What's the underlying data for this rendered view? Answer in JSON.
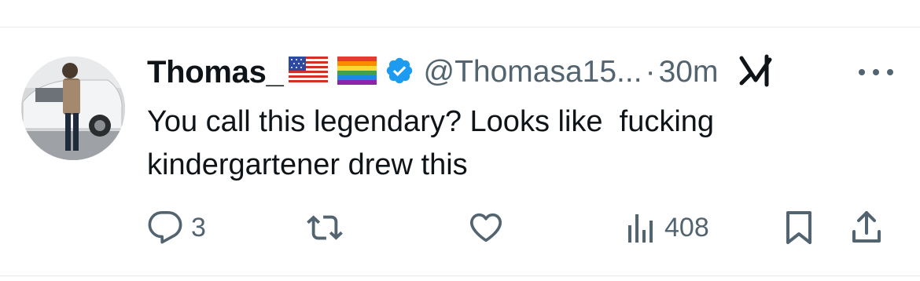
{
  "tweet": {
    "author_name": "Thomas_",
    "handle": "@Thomasa15...",
    "separator": "·",
    "time": "30m",
    "text_line1": "You call this legendary? Looks like  fucking",
    "text_line2": "kindergartener drew this"
  },
  "badges": {
    "flag1": "us-flag",
    "flag2": "rainbow-flag",
    "verified_color": "#1d9bf0"
  },
  "actions": {
    "reply_count": "3",
    "repost_count": "",
    "like_count": "",
    "views_count": "408"
  },
  "colors": {
    "text": "#0f1419",
    "muted": "#536471",
    "divider": "#e6e9ec"
  }
}
